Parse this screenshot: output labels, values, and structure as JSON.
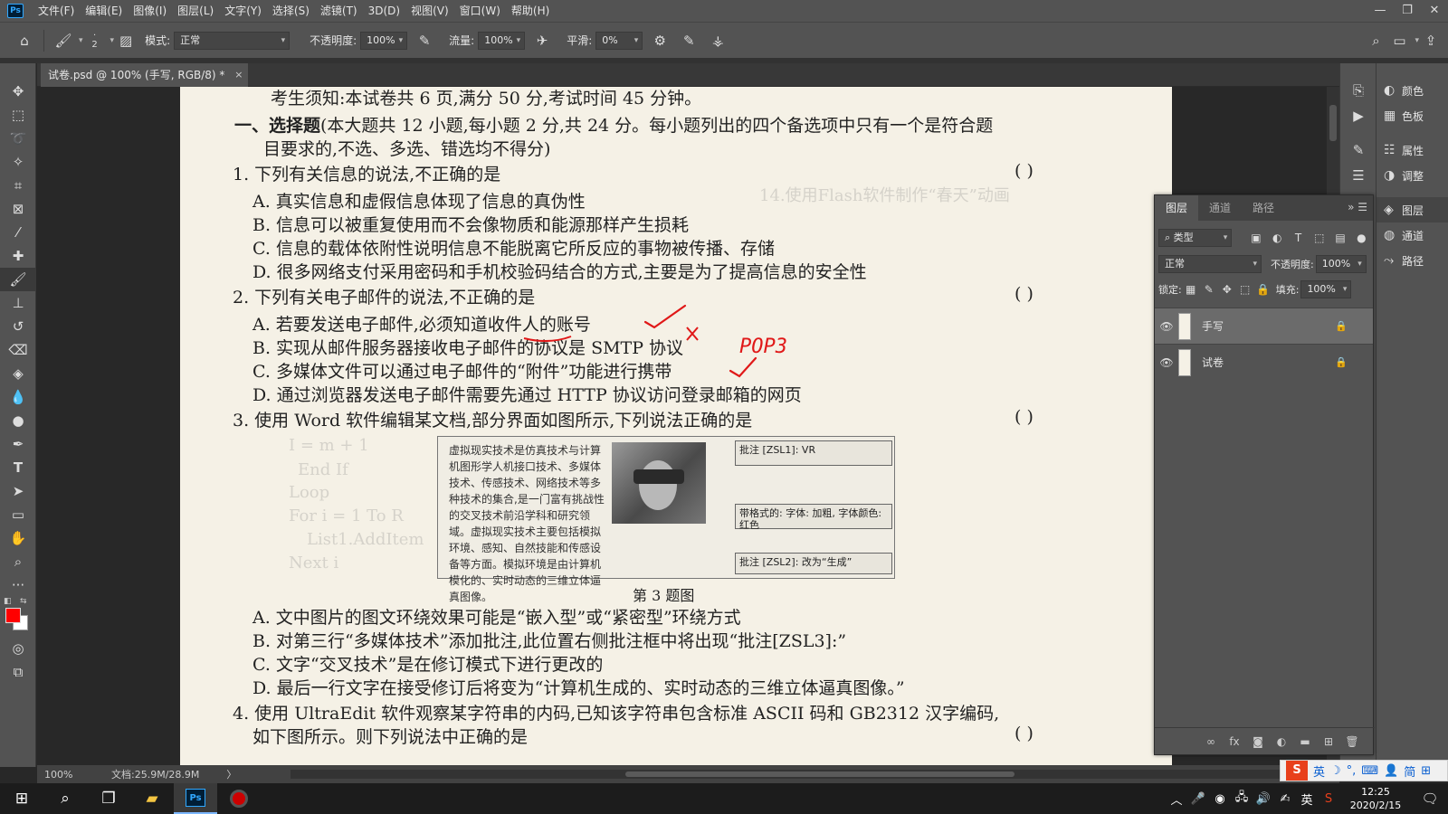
{
  "app": {
    "logo": "Ps",
    "menu": [
      "文件(F)",
      "编辑(E)",
      "图像(I)",
      "图层(L)",
      "文字(Y)",
      "选择(S)",
      "滤镜(T)",
      "3D(D)",
      "视图(V)",
      "窗口(W)",
      "帮助(H)"
    ],
    "window_controls": [
      "—",
      "❐",
      "✕"
    ]
  },
  "options": {
    "brush_size": "2",
    "mode_label": "模式:",
    "mode_value": "正常",
    "opacity_label": "不透明度:",
    "opacity_value": "100%",
    "flow_label": "流量:",
    "flow_value": "100%",
    "smoothing_label": "平滑:",
    "smoothing_value": "0%"
  },
  "document": {
    "tab_title": "试卷.psd @ 100% (手写, RGB/8) *",
    "close": "×"
  },
  "toolbar": {
    "colors": {
      "foreground": "#ff0000",
      "background": "#ffffff"
    }
  },
  "paper": {
    "notice": "考生须知:本试卷共 6 页,满分 50 分,考试时间 45 分钟。",
    "section_title": "一、选择题",
    "section_desc_1": "(本大题共 12 小题,每小题 2 分,共 24 分。每小题列出的四个备选项中只有一个是符合题",
    "section_desc_2": "目要求的,不选、多选、错选均不得分)",
    "q1": "1. 下列有关信息的说法,不正确的是",
    "q1_options": [
      "A. 真实信息和虚假信息体现了信息的真伪性",
      "B. 信息可以被重复使用而不会像物质和能源那样产生损耗",
      "C. 信息的载体依附性说明信息不能脱离它所反应的事物被传播、存储",
      "D. 很多网络支付采用密码和手机校验码结合的方式,主要是为了提高信息的安全性"
    ],
    "q2": "2. 下列有关电子邮件的说法,不正确的是",
    "q2_options": [
      "A. 若要发送电子邮件,必须知道收件人的账号",
      "B. 实现从邮件服务器接收电子邮件的协议是 SMTP 协议",
      "C. 多媒体文件可以通过电子邮件的“附件”功能进行携带",
      "D. 通过浏览器发送电子邮件需要先通过 HTTP 协议访问登录邮箱的网页"
    ],
    "q3": "3. 使用 Word 软件编辑某文档,部分界面如图所示,下列说法正确的是",
    "figure": {
      "body": "虚拟现实技术是仿真技术与计算机图形学人机接口技术、多媒体技术、传感技术、网络技术等多种技术的集合,是一门富有挑战性的交叉技术前沿学科和研究领域。虚拟现实技术主要包括模拟环境、感知、自然技能和传感设备等方面。模拟环境是由计算机模化的、实时动态的三维立体逼真图像。",
      "note1": "批注 [ZSL1]: VR",
      "note2": "带格式的: 字体: 加粗, 字体颜色: 红色",
      "note3": "批注 [ZSL2]: 改为“生成”",
      "caption": "第 3 题图"
    },
    "q3_options": [
      "A. 文中图片的图文环绕效果可能是“嵌入型”或“紧密型”环绕方式",
      "B. 对第三行“多媒体技术”添加批注,此位置右侧批注框中将出现“批注[ZSL3]:”",
      "C. 文字“交叉技术”是在修订模式下进行更改的",
      "D. 最后一行文字在接受修订后将变为“计算机生成的、实时动态的三维立体逼真图像。”"
    ],
    "q4_line1": "4. 使用 UltraEdit 软件观察某字符串的内码,已知该字符串包含标准 ASCII 码和 GB2312 汉字编码,",
    "q4_line2": "如下图所示。则下列说法中正确的是",
    "answer_paren": "(      )",
    "handwriting": "POP3"
  },
  "status": {
    "zoom": "100%",
    "doc_size": "文档:25.9M/28.9M",
    "arrow": "〉"
  },
  "right_panels": [
    {
      "icon": "palette-icon",
      "label": "颜色"
    },
    {
      "icon": "swatches-icon",
      "label": "色板"
    },
    {
      "icon": "properties-icon",
      "label": "属性"
    },
    {
      "icon": "adjustments-icon",
      "label": "调整"
    },
    {
      "icon": "layers-icon",
      "label": "图层"
    },
    {
      "icon": "channels-icon",
      "label": "通道"
    },
    {
      "icon": "paths-icon",
      "label": "路径"
    }
  ],
  "layers_panel": {
    "tabs": [
      "图层",
      "通道",
      "路径"
    ],
    "filter_label": "类型",
    "blend_mode": "正常",
    "opacity_label": "不透明度:",
    "opacity_value": "100%",
    "lock_label": "锁定:",
    "fill_label": "填充:",
    "fill_value": "100%",
    "layers": [
      {
        "name": "手写",
        "selected": true
      },
      {
        "name": "试卷",
        "selected": false
      }
    ]
  },
  "ime": {
    "logo": "S",
    "items": [
      "英",
      "☽",
      "°,",
      "⌨",
      "👤",
      "简",
      "⊞"
    ]
  },
  "taskbar": {
    "clock_time": "12:25",
    "clock_date": "2020/2/15",
    "ime_label": "英",
    "ps_label": "Ps"
  }
}
